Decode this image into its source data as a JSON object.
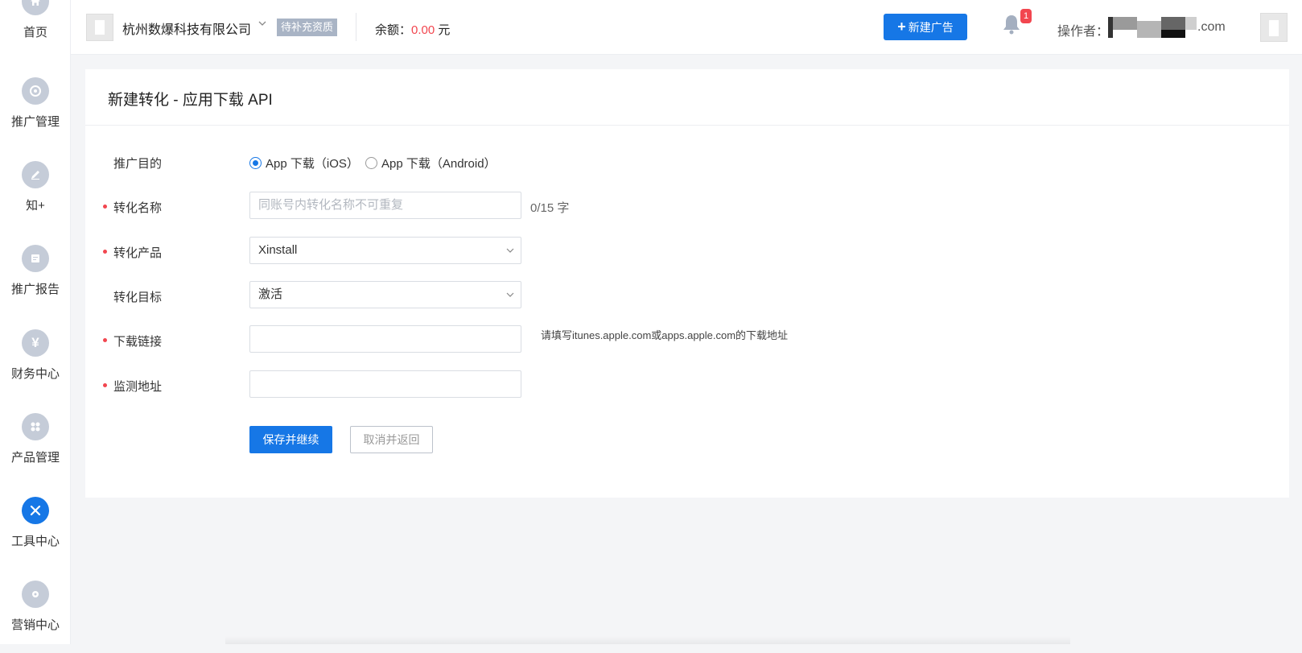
{
  "sidebar": {
    "items": [
      {
        "label": "首页",
        "icon": "home-icon",
        "active": false
      },
      {
        "label": "推广管理",
        "icon": "promotion-icon",
        "active": false
      },
      {
        "label": "知+",
        "icon": "pen-icon",
        "active": false
      },
      {
        "label": "推广报告",
        "icon": "report-icon",
        "active": false
      },
      {
        "label": "财务中心",
        "icon": "yen-icon",
        "active": false
      },
      {
        "label": "产品管理",
        "icon": "grid-icon",
        "active": false
      },
      {
        "label": "工具中心",
        "icon": "tools-icon",
        "active": true
      },
      {
        "label": "营销中心",
        "icon": "marketing-icon",
        "active": false
      }
    ]
  },
  "header": {
    "company_name": "杭州数爆科技有限公司",
    "qualification_badge": "待补充资质",
    "balance_label": "余额：",
    "balance_amount": "0.00",
    "balance_unit": "元",
    "new_ad_label": "新建广告",
    "notification_count": "1",
    "operator_label": "操作者：",
    "operator_domain": ".com"
  },
  "form": {
    "title": "新建转化 - 应用下载 API",
    "purpose": {
      "label": "推广目的",
      "options": [
        {
          "label": "App 下载（iOS）",
          "checked": true
        },
        {
          "label": "App 下载（Android）",
          "checked": false
        }
      ]
    },
    "name": {
      "label": "转化名称",
      "placeholder": "同账号内转化名称不可重复",
      "count": "0/15 字"
    },
    "product": {
      "label": "转化产品",
      "value": "Xinstall"
    },
    "target": {
      "label": "转化目标",
      "value": "激活"
    },
    "download_link": {
      "label": "下载链接",
      "value": "",
      "hint": "请填写itunes.apple.com或apps.apple.com的下载地址"
    },
    "monitor_url": {
      "label": "监测地址",
      "value": ""
    },
    "save_label": "保存并继续",
    "cancel_label": "取消并返回"
  },
  "colors": {
    "primary": "#1677e6",
    "danger": "#f2464f",
    "sidebar_icon": "#c5ccd8",
    "badge": "#a9b4c5"
  }
}
